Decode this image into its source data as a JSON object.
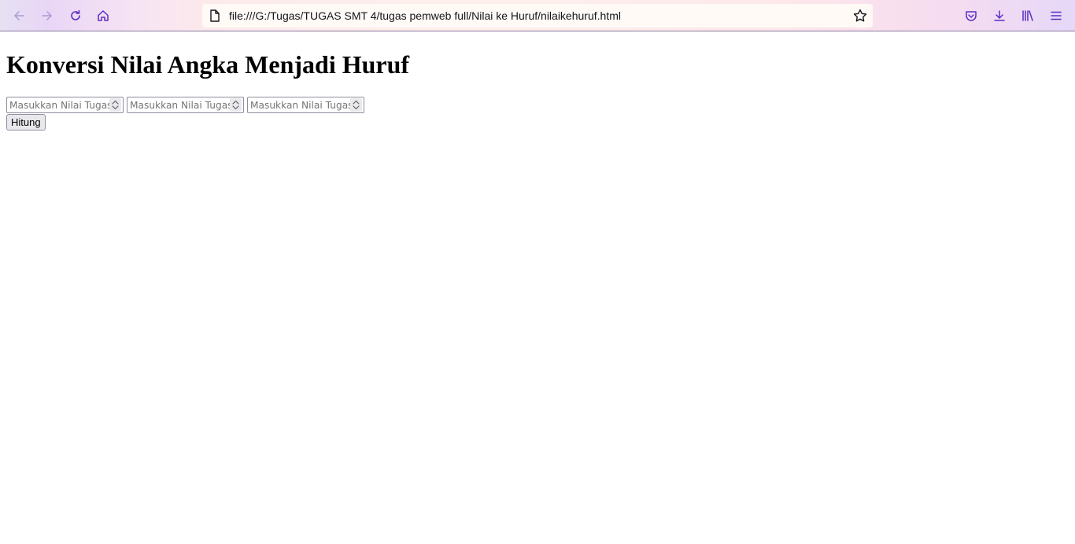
{
  "browser": {
    "url": "file:///G:/Tugas/TUGAS SMT 4/tugas pemweb full/Nilai ke Huruf/nilaikehuruf.html",
    "icons": [
      "back-icon",
      "forward-icon",
      "reload-icon",
      "home-icon",
      "page-icon",
      "bookmark-star-icon",
      "pocket-icon",
      "download-icon",
      "library-icon",
      "menu-icon"
    ],
    "accent_color": "#7b2ff7"
  },
  "page": {
    "heading": "Konversi Nilai Angka Menjadi Huruf",
    "inputs": [
      {
        "placeholder": "Masukkan Nilai Tugas",
        "value": ""
      },
      {
        "placeholder": "Masukkan Nilai Tugas",
        "value": ""
      },
      {
        "placeholder": "Masukkan Nilai Tugas",
        "value": ""
      }
    ],
    "button_label": "Hitung"
  }
}
